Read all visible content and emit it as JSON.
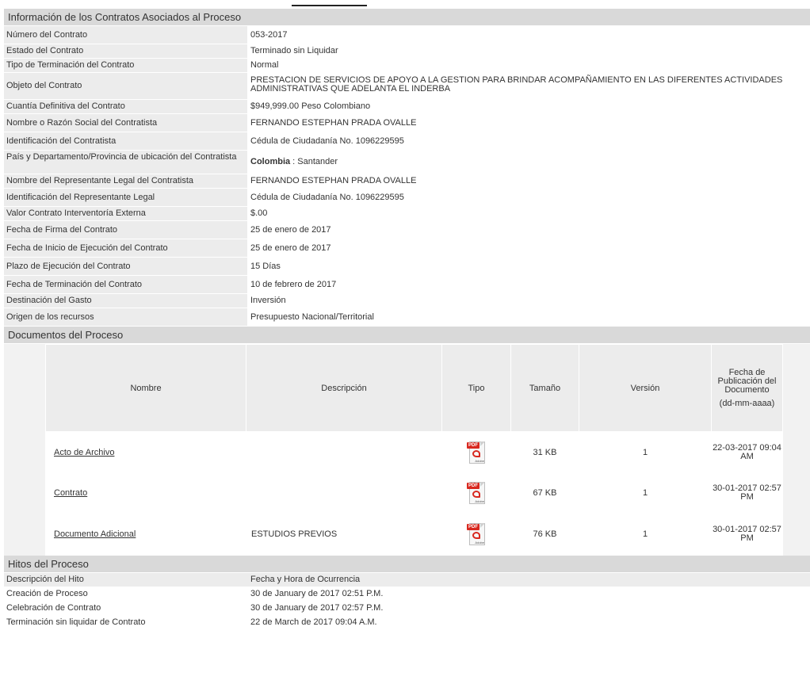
{
  "contracts": {
    "header": "Información de los Contratos Asociados al Proceso",
    "rows": [
      {
        "label": "Número del Contrato",
        "value": "053-2017"
      },
      {
        "label": "Estado del Contrato",
        "value": "Terminado sin Liquidar"
      },
      {
        "label": "Tipo de Terminación del Contrato",
        "value": "Normal"
      },
      {
        "label": "Objeto del Contrato",
        "value": "PRESTACION DE SERVICIOS DE APOYO A LA GESTION PARA BRINDAR ACOMPAÑAMIENTO EN LAS DIFERENTES ACTIVIDADES ADMINISTRATIVAS QUE ADELANTA EL INDERBA"
      },
      {
        "label": "Cuantía Definitiva del Contrato",
        "value": "$949,999.00 Peso Colombiano"
      },
      {
        "label": "Nombre o Razón Social del Contratista",
        "value": "FERNANDO ESTEPHAN PRADA OVALLE"
      },
      {
        "label": "Identificación del Contratista",
        "value": "Cédula de Ciudadanía No. 1096229595"
      },
      {
        "label": "País y Departamento/Provincia de ubicación del Contratista",
        "value_bold": "Colombia",
        "value": " : Santander"
      },
      {
        "label": "Nombre del Representante Legal del Contratista",
        "value": "FERNANDO ESTEPHAN PRADA OVALLE"
      },
      {
        "label": "Identificación del Representante Legal",
        "value": "Cédula de Ciudadanía No. 1096229595"
      },
      {
        "label": "Valor Contrato Interventoría Externa",
        "value": "$.00"
      },
      {
        "label": "Fecha de Firma del Contrato",
        "value": "25 de enero de 2017"
      },
      {
        "label": "Fecha de Inicio de Ejecución del Contrato",
        "value": "25 de enero de 2017"
      },
      {
        "label": "Plazo de Ejecución del Contrato",
        "value": "15 Días"
      },
      {
        "label": "Fecha de Terminación del Contrato",
        "value": "10 de febrero de 2017"
      },
      {
        "label": "Destinación del Gasto",
        "value": "Inversión"
      },
      {
        "label": "Origen de los recursos",
        "value": "Presupuesto Nacional/Territorial"
      }
    ]
  },
  "documents": {
    "header": "Documentos del Proceso",
    "columns": {
      "name": "Nombre",
      "description": "Descripción",
      "type": "Tipo",
      "size": "Tamaño",
      "version": "Versión",
      "date_line1": "Fecha de Publicación del Documento",
      "date_line2": "(dd-mm-aaaa)"
    },
    "rows": [
      {
        "name": "Acto de Archivo",
        "description": "",
        "type": "pdf-icon",
        "size": "31 KB",
        "version": "1",
        "date": "22-03-2017 09:04 AM"
      },
      {
        "name": "Contrato",
        "description": "",
        "type": "pdf-icon",
        "size": "67 KB",
        "version": "1",
        "date": "30-01-2017 02:57 PM"
      },
      {
        "name": "Documento Adicional",
        "description": "ESTUDIOS PREVIOS",
        "type": "pdf-icon",
        "size": "76 KB",
        "version": "1",
        "date": "30-01-2017 02:57 PM"
      }
    ]
  },
  "milestones": {
    "header": "Hitos del Proceso",
    "col_description": "Descripción del Hito",
    "col_datetime": "Fecha y Hora de Ocurrencia",
    "rows": [
      {
        "label": "Creación de Proceso",
        "value": "30 de January de 2017 02:51 P.M."
      },
      {
        "label": "Celebración de Contrato",
        "value": "30 de January de 2017 02:57 P.M."
      },
      {
        "label": "Terminación sin liquidar de Contrato",
        "value": "22 de March de 2017 09:04 A.M."
      }
    ]
  }
}
